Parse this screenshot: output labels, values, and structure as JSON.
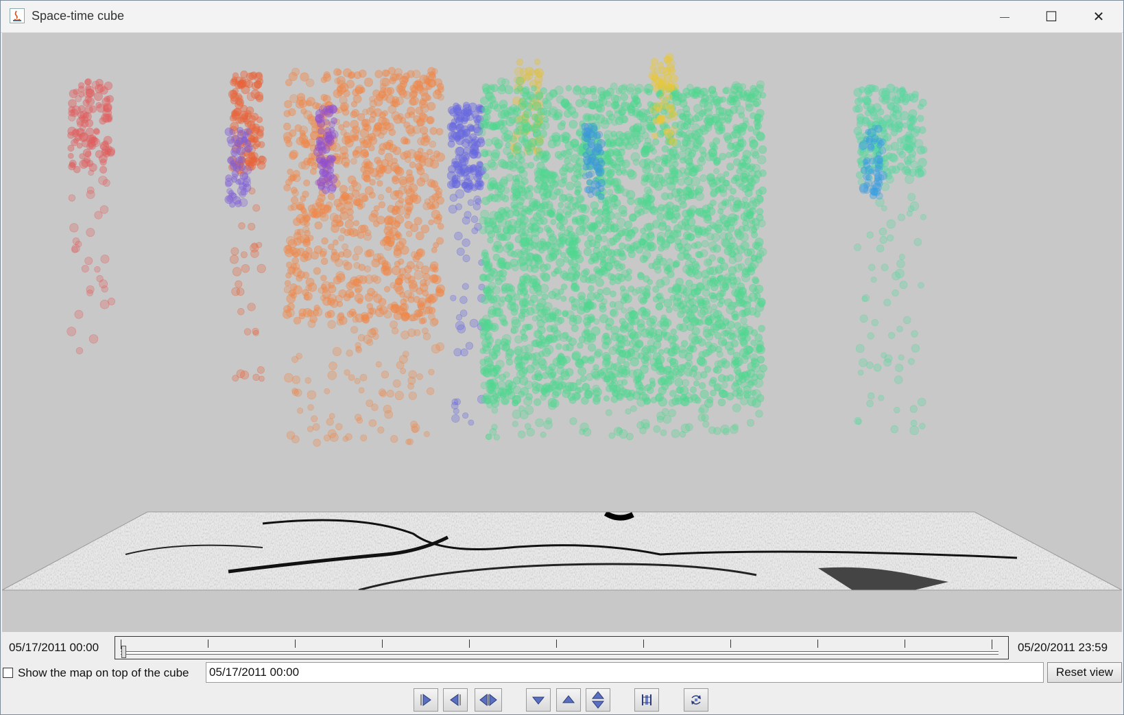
{
  "window": {
    "title": "Space-time cube",
    "minimize_glyph": "—",
    "maximize_glyph": "☐",
    "close_glyph": "✕"
  },
  "timeline": {
    "start_label": "05/17/2011 00:00",
    "end_label": "05/20/2011 23:59",
    "position": 0.0
  },
  "options": {
    "show_map_label": "Show the map on top of the cube",
    "show_map_checked": false,
    "current_time": "05/17/2011 00:00",
    "reset_label": "Reset view"
  },
  "controls": [
    {
      "name": "play-forward-button",
      "icon": "play-right-icon"
    },
    {
      "name": "play-backward-button",
      "icon": "play-left-icon"
    },
    {
      "name": "play-both-button",
      "icon": "play-both-icon"
    },
    {
      "name": "move-down-button",
      "icon": "triangle-down-icon"
    },
    {
      "name": "move-up-button",
      "icon": "triangle-up-icon"
    },
    {
      "name": "move-up-down-button",
      "icon": "up-down-icon"
    },
    {
      "name": "fit-cube-button",
      "icon": "fit-icon"
    },
    {
      "name": "rotate-view-button",
      "icon": "rotate-icon"
    }
  ],
  "clusters": [
    {
      "color": "#e06060",
      "kind": "tall"
    },
    {
      "color": "#e8643a",
      "kind": "tall"
    },
    {
      "color": "#8060d8",
      "kind": "tall"
    },
    {
      "color": "#f0884a",
      "kind": "block"
    },
    {
      "color": "#9050d0",
      "kind": "tall"
    },
    {
      "color": "#6868e0",
      "kind": "tall"
    },
    {
      "color": "#e0c040",
      "kind": "tall"
    },
    {
      "color": "#50d890",
      "kind": "block"
    },
    {
      "color": "#3a98d8",
      "kind": "tall"
    },
    {
      "color": "#e8c838",
      "kind": "tall"
    },
    {
      "color": "#58d8a0",
      "kind": "tall"
    },
    {
      "color": "#3aa0e0",
      "kind": "tall"
    }
  ]
}
